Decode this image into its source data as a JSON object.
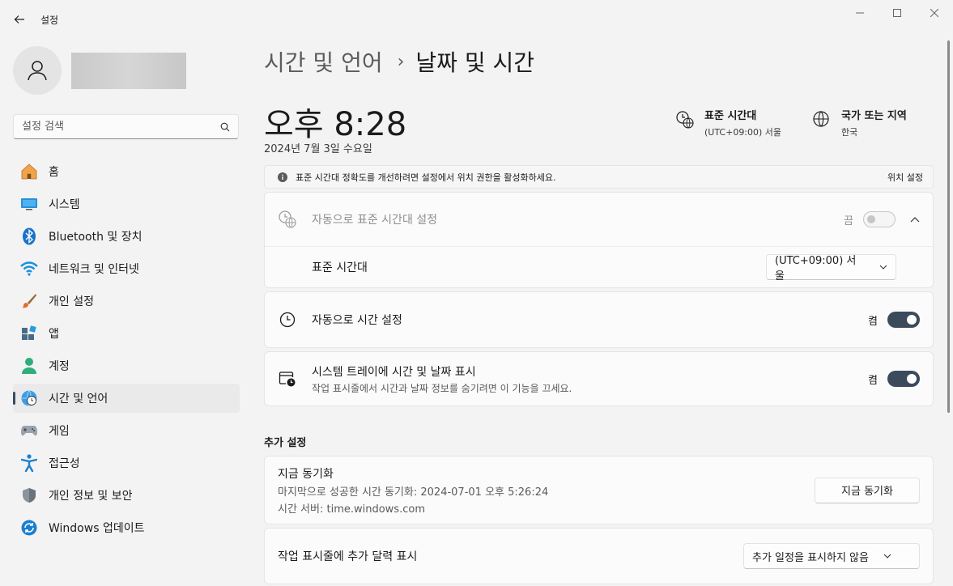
{
  "window": {
    "title": "설정"
  },
  "profile": {
    "avatar_icon": "person-icon"
  },
  "search": {
    "placeholder": "설정 검색"
  },
  "sidebar": {
    "items": [
      {
        "label": "홈",
        "icon": "home-icon"
      },
      {
        "label": "시스템",
        "icon": "monitor-icon"
      },
      {
        "label": "Bluetooth 및 장치",
        "icon": "bluetooth-icon"
      },
      {
        "label": "네트워크 및 인터넷",
        "icon": "wifi-icon"
      },
      {
        "label": "개인 설정",
        "icon": "brush-icon"
      },
      {
        "label": "앱",
        "icon": "apps-icon"
      },
      {
        "label": "계정",
        "icon": "account-icon"
      },
      {
        "label": "시간 및 언어",
        "icon": "globe-clock-icon",
        "active": true
      },
      {
        "label": "게임",
        "icon": "gamepad-icon"
      },
      {
        "label": "접근성",
        "icon": "accessibility-icon"
      },
      {
        "label": "개인 정보 및 보안",
        "icon": "shield-icon"
      },
      {
        "label": "Windows 업데이트",
        "icon": "update-icon"
      }
    ]
  },
  "breadcrumb": {
    "parent": "시간 및 언어",
    "separator": "›",
    "current": "날짜 및 시간"
  },
  "clock": {
    "time": "오후 8:28",
    "date": "2024년 7월 3일 수요일"
  },
  "timezone_info": {
    "title": "표준 시간대",
    "value": "(UTC+09:00) 서울"
  },
  "region_info": {
    "title": "국가 또는 지역",
    "value": "한국"
  },
  "banner": {
    "text": "표준 시간대 정확도를 개선하려면 설정에서 위치 권한을 활성화하세요.",
    "link": "위치 설정"
  },
  "auto_timezone": {
    "label": "자동으로 표준 시간대 설정",
    "state": "끔",
    "enabled": false
  },
  "timezone_setting": {
    "label": "표준 시간대",
    "value": "(UTC+09:00) 서울"
  },
  "auto_time": {
    "label": "자동으로 시간 설정",
    "state": "켬",
    "enabled": true
  },
  "tray_time": {
    "label": "시스템 트레이에 시간 및 날짜 표시",
    "sub": "작업 표시줄에서 시간과 날짜 정보를 숨기려면 이 기능을 끄세요.",
    "state": "켬",
    "enabled": true
  },
  "additional": {
    "title": "추가 설정",
    "sync": {
      "label": "지금 동기화",
      "last_sync": "마지막으로 성공한 시간 동기화: 2024-07-01 오후 5:26:24",
      "server": "시간 서버: time.windows.com",
      "button": "지금 동기화"
    },
    "calendar": {
      "label": "작업 표시줄에 추가 달력 표시",
      "value": "추가 일정을 표시하지 않음"
    }
  },
  "colors": {
    "accent": "#3b4b5c",
    "background": "#f3f3f3",
    "card": "#fbfbfb"
  }
}
